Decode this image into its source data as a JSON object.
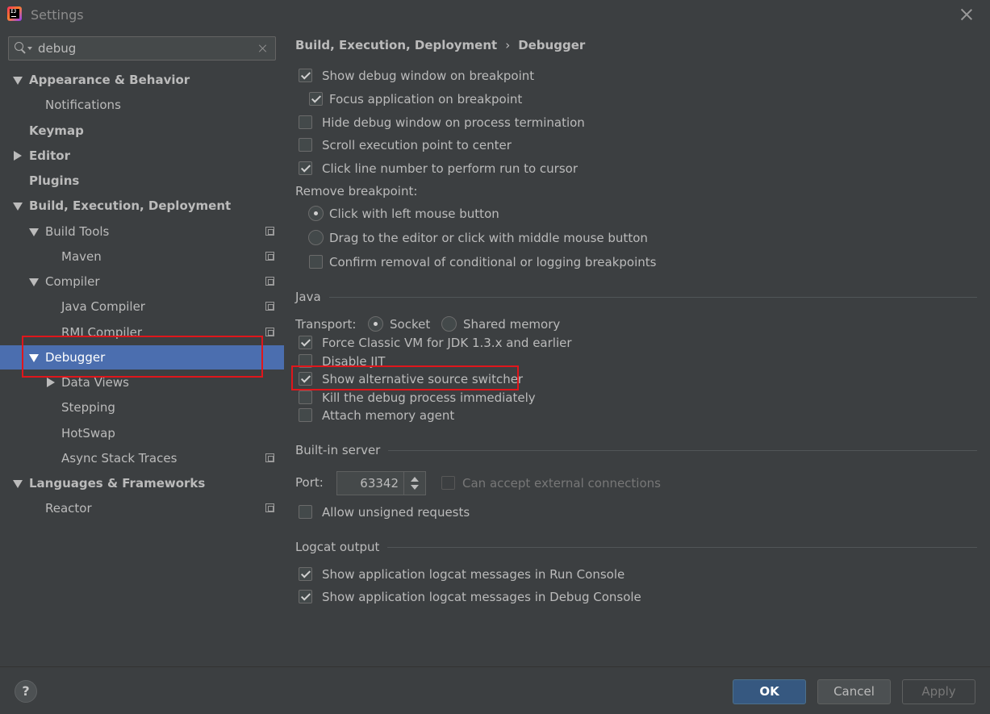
{
  "window": {
    "title": "Settings"
  },
  "search": {
    "value": "debug"
  },
  "tree": [
    {
      "label": "Appearance & Behavior"
    },
    {
      "label": "Notifications"
    },
    {
      "label": "Keymap"
    },
    {
      "label": "Editor"
    },
    {
      "label": "Plugins"
    },
    {
      "label": "Build, Execution, Deployment"
    },
    {
      "label": "Build Tools"
    },
    {
      "label": "Maven"
    },
    {
      "label": "Compiler"
    },
    {
      "label": "Java Compiler"
    },
    {
      "label": "RMI Compiler"
    },
    {
      "label": "Debugger"
    },
    {
      "label": "Data Views"
    },
    {
      "label": "Stepping"
    },
    {
      "label": "HotSwap"
    },
    {
      "label": "Async Stack Traces"
    },
    {
      "label": "Languages & Frameworks"
    },
    {
      "label": "Reactor"
    }
  ],
  "breadcrumb": {
    "parent": "Build, Execution, Deployment",
    "separator": "›",
    "current": "Debugger"
  },
  "general": {
    "show_debug_window": "Show debug window on breakpoint",
    "focus_application": "Focus application on breakpoint",
    "hide_debug_window": "Hide debug window on process termination",
    "scroll_execution": "Scroll execution point to center",
    "click_line_number": "Click line number to perform run to cursor",
    "remove_breakpoint_label": "Remove breakpoint:",
    "click_left": "Click with left mouse button",
    "drag_to_editor": "Drag to the editor or click with middle mouse button",
    "confirm_removal": "Confirm removal of conditional or logging breakpoints"
  },
  "java": {
    "title": "Java",
    "transport_label": "Transport:",
    "socket": "Socket",
    "shared_memory": "Shared memory",
    "force_classic": "Force Classic VM for JDK 1.3.x and earlier",
    "disable_jit": "Disable JIT",
    "show_alt_source": "Show alternative source switcher",
    "kill_debug": "Kill the debug process immediately",
    "attach_memory": "Attach memory agent"
  },
  "server": {
    "title": "Built-in server",
    "port_label": "Port:",
    "port_value": "63342",
    "external": "Can accept external connections",
    "unsigned": "Allow unsigned requests"
  },
  "logcat": {
    "title": "Logcat output",
    "run_console": "Show application logcat messages in Run Console",
    "debug_console": "Show application logcat messages in Debug Console"
  },
  "footer": {
    "help": "?",
    "ok": "OK",
    "cancel": "Cancel",
    "apply": "Apply"
  },
  "colors": {
    "background": "#3c3f41",
    "selection": "#4b6eaf",
    "highlight": "#e0161b",
    "ok_button": "#365880"
  }
}
